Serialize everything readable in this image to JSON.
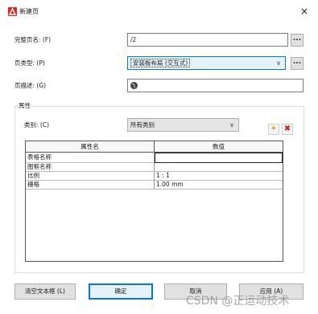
{
  "window": {
    "title": "新建页",
    "close_glyph": "×"
  },
  "form": {
    "full_name_label": "完整页名: (F)",
    "full_name_value": "/2",
    "page_type_label": "页类型: (P)",
    "page_type_value": "安装板布局 (交互式)",
    "description_label": "页描述: (G)",
    "browse_glyph": "..."
  },
  "properties": {
    "group_label": "属性",
    "category_label": "类别: (C)",
    "category_value": "所有类别",
    "table": {
      "headers": [
        "属性名",
        "数值"
      ],
      "rows": [
        {
          "name": "表格名称",
          "value": ""
        },
        {
          "name": "图框名称",
          "value": ""
        },
        {
          "name": "比例",
          "value": "1 : 1"
        },
        {
          "name": "栅格",
          "value": "1.00 mm"
        }
      ]
    }
  },
  "buttons": {
    "clear_textbox": "清空文本框 (L)",
    "ok": "确定",
    "cancel": "取消",
    "apply": "应用 (A)"
  },
  "watermark": "CSDN @正运动技术",
  "colors": {
    "accent": "#0078d7",
    "app_icon": "#e0261c",
    "delete_icon": "#c4201a",
    "add_icon": "#e8a21a"
  }
}
